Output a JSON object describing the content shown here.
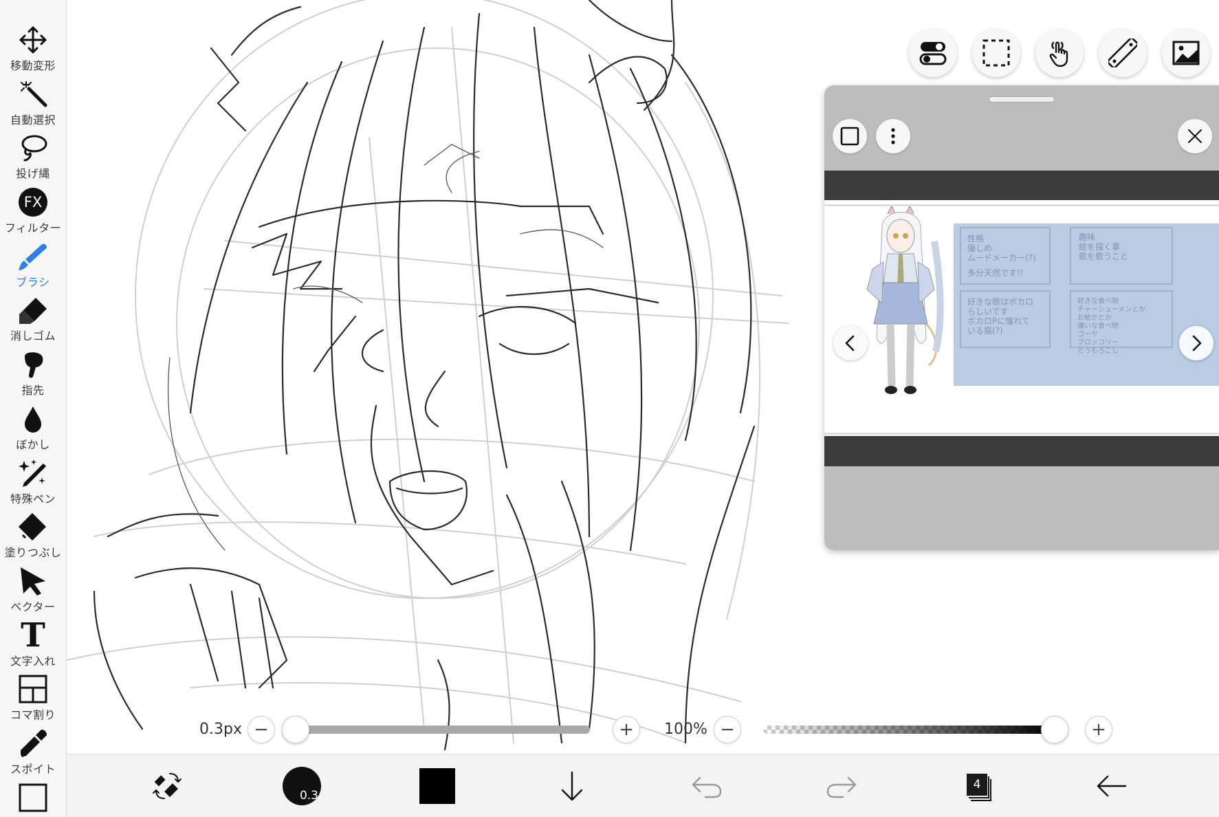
{
  "toolbar": {
    "tools": [
      {
        "label": "移動変形",
        "icon": "move-transform-icon"
      },
      {
        "label": "自動選択",
        "icon": "magic-wand-icon"
      },
      {
        "label": "投げ縄",
        "icon": "lasso-icon"
      },
      {
        "label": "フィルター",
        "icon": "fx-filter-icon"
      },
      {
        "label": "ブラシ",
        "icon": "brush-icon",
        "active": true
      },
      {
        "label": "消しゴム",
        "icon": "eraser-icon"
      },
      {
        "label": "指先",
        "icon": "finger-smudge-icon"
      },
      {
        "label": "ぼかし",
        "icon": "blur-drop-icon"
      },
      {
        "label": "特殊ペン",
        "icon": "special-pen-icon"
      },
      {
        "label": "塗りつぶし",
        "icon": "fill-bucket-icon"
      },
      {
        "label": "ベクター",
        "icon": "vector-cursor-icon"
      },
      {
        "label": "文字入れ",
        "icon": "text-icon"
      },
      {
        "label": "コマ割り",
        "icon": "frame-divide-icon"
      },
      {
        "label": "スポイト",
        "icon": "eyedropper-icon"
      }
    ],
    "fx_text": "FX",
    "text_tool_glyph": "T",
    "accent_color": "#2f7fe6"
  },
  "top_buttons": [
    {
      "name": "toggle-settings-button",
      "icon": "toggle-icon"
    },
    {
      "name": "selection-button",
      "icon": "dashed-selection-icon"
    },
    {
      "name": "hand-tool-button",
      "icon": "hand-pointer-icon"
    },
    {
      "name": "ruler-button",
      "icon": "ruler-icon"
    },
    {
      "name": "reference-image-button",
      "icon": "image-icon"
    }
  ],
  "reference_panel": {
    "sheet_notes": [
      "性格\n優しめ\nムードメーカー(?)\n\n多分天然です!!",
      "趣味\n絵を描く事\n歌を歌うこと",
      "好きな歌はボカロ\nらしいです\nボカロPに憧れて\nいる猫(?)",
      "好きな食べ物\nチャーシューメンとか\nお絵かとか\n嫌いな食べ物\nゴーヤ\nブロッコリー\nとうもろこし"
    ],
    "panel_bg": "#bdbdbd",
    "sheet_color": "#b9cce3"
  },
  "sliders": {
    "brush_size_label": "0.3px",
    "brush_size_fraction": 0.0,
    "zoom_label": "100%",
    "opacity_fraction": 1.0,
    "minus_glyph": "−",
    "plus_glyph": "+"
  },
  "bottombar": {
    "brush_dot_label": "0.3",
    "current_color": "#000000",
    "layer_count": "4"
  }
}
